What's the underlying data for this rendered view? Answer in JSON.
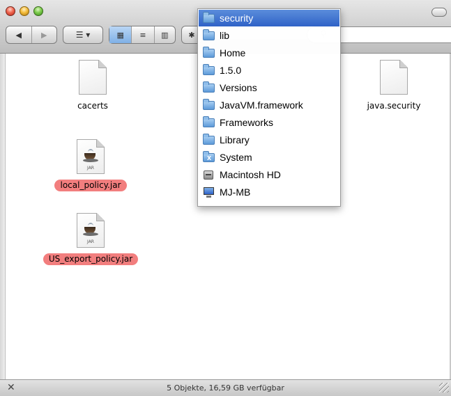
{
  "window": {
    "title": "security"
  },
  "toolbar": {
    "back_icon": "back-arrow-icon",
    "forward_icon": "forward-arrow-icon",
    "action_icon": "action-menu-icon",
    "view_modes": [
      "icon-view-icon",
      "list-view-icon",
      "column-view-icon"
    ],
    "search_placeholder": ""
  },
  "files": [
    {
      "name": "cacerts",
      "kind": "document",
      "selected": false
    },
    {
      "name": "java.security",
      "kind": "document",
      "selected": false
    },
    {
      "name": "local_policy.jar",
      "kind": "jar",
      "selected": true,
      "icon_label": "JAR"
    },
    {
      "name": "US_export_policy.jar",
      "kind": "jar",
      "selected": true,
      "icon_label": "JAR"
    }
  ],
  "path_menu": {
    "items": [
      {
        "label": "security",
        "icon": "folder-icon",
        "highlighted": true
      },
      {
        "label": "lib",
        "icon": "folder-icon"
      },
      {
        "label": "Home",
        "icon": "folder-icon"
      },
      {
        "label": "1.5.0",
        "icon": "folder-icon"
      },
      {
        "label": "Versions",
        "icon": "folder-icon"
      },
      {
        "label": "JavaVM.framework",
        "icon": "folder-icon"
      },
      {
        "label": "Frameworks",
        "icon": "folder-icon"
      },
      {
        "label": "Library",
        "icon": "folder-icon"
      },
      {
        "label": "System",
        "icon": "system-folder-icon"
      },
      {
        "label": "Macintosh HD",
        "icon": "hard-drive-icon"
      },
      {
        "label": "MJ-MB",
        "icon": "computer-icon"
      }
    ]
  },
  "status_bar": {
    "text": "5 Objekte, 16,59 GB verfügbar"
  },
  "colors": {
    "selection_label": "#f27e7e",
    "menu_highlight": "#2f62c7"
  }
}
